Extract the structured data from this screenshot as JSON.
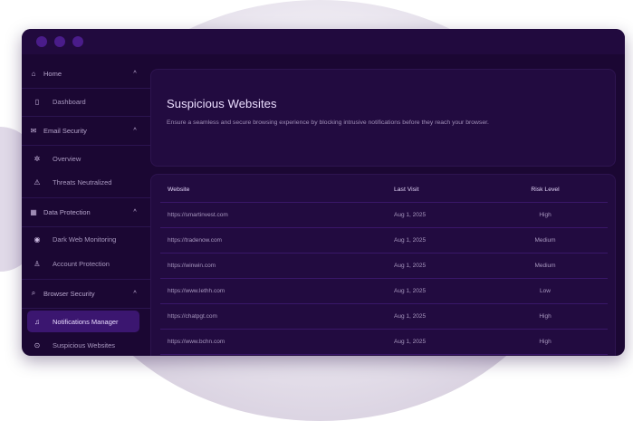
{
  "sidebar": {
    "sections": [
      {
        "label": "Home",
        "icon": "home-icon",
        "items": [
          {
            "label": "Dashboard",
            "icon": "book-icon"
          }
        ]
      },
      {
        "label": "Email Security",
        "icon": "mail-icon",
        "items": [
          {
            "label": "Overview",
            "icon": "settings-icon"
          },
          {
            "label": "Threats Neutralized",
            "icon": "warning-icon"
          }
        ]
      },
      {
        "label": "Data Protection",
        "icon": "grid-icon",
        "items": [
          {
            "label": "Dark Web Monitoring",
            "icon": "eye-icon"
          },
          {
            "label": "Account Protection",
            "icon": "user-icon"
          }
        ]
      },
      {
        "label": "Browser Security",
        "icon": "search-icon",
        "items": [
          {
            "label": "Notifications Manager",
            "icon": "bell-icon"
          },
          {
            "label": "Suspicious Websites",
            "icon": "alert-icon"
          }
        ]
      }
    ],
    "chevron": "^"
  },
  "header": {
    "title": "Suspicious Websites",
    "description": "Ensure a seamless and secure browsing experience by blocking intrusive notifications before they reach your browser."
  },
  "table": {
    "columns": [
      "Website",
      "Last Visit",
      "Risk Level"
    ],
    "rows": [
      {
        "website": "https://smartinvest.com",
        "last_visit": "Aug 1, 2025",
        "risk": "High"
      },
      {
        "website": "https://tradenow.com",
        "last_visit": "Aug 1, 2025",
        "risk": "Medium"
      },
      {
        "website": "https://winwin.com",
        "last_visit": "Aug 1, 2025",
        "risk": "Medium"
      },
      {
        "website": "https://www.lethh.com",
        "last_visit": "Aug 1, 2025",
        "risk": "Low"
      },
      {
        "website": "https://chatpgt.com",
        "last_visit": "Aug 1, 2025",
        "risk": "High"
      },
      {
        "website": "https://www.bchn.com",
        "last_visit": "Aug 1, 2025",
        "risk": "High"
      }
    ]
  },
  "colors": {
    "window_bg": "#1b0733",
    "card_bg": "#220b40",
    "active_item": "#3b1670",
    "divider": "#3a1769"
  }
}
